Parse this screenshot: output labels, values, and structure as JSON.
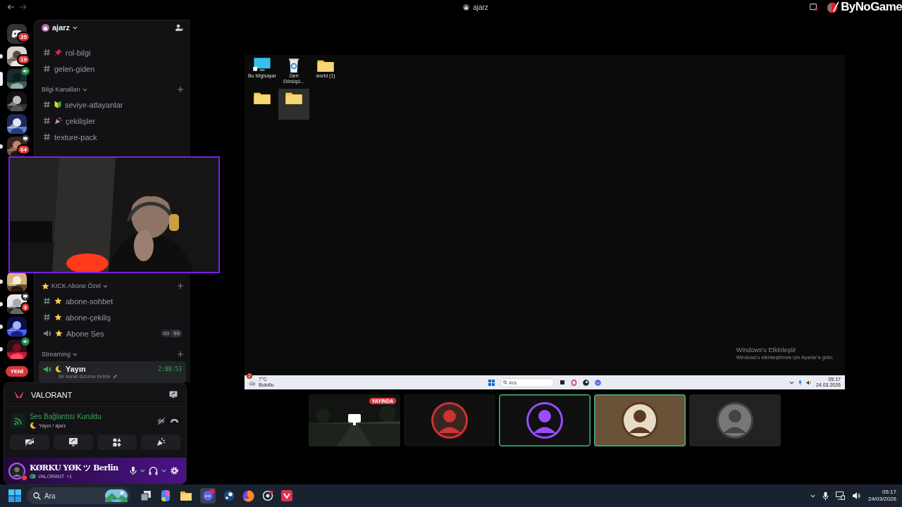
{
  "titlebar": {
    "title": "ajarz",
    "brand": "ByNoGame"
  },
  "servers": [
    {
      "kind": "home",
      "badge": "25",
      "unread": false,
      "selected": false
    },
    {
      "kind": "picture",
      "badge": "19",
      "unread": true,
      "selected": false
    },
    {
      "kind": "picture",
      "activity": {
        "kind": "voice"
      },
      "unread": false,
      "selected": true
    },
    {
      "kind": "picture",
      "unread": false,
      "selected": false
    },
    {
      "kind": "picture",
      "unread": false,
      "selected": false
    },
    {
      "kind": "picture",
      "badge": "64",
      "activity": {
        "kind": "screen"
      },
      "unread": true,
      "selected": false
    },
    {
      "kind": "picture",
      "unread": true,
      "selected": false
    },
    {
      "kind": "picture",
      "badge": "3",
      "activity": {
        "kind": "screen"
      },
      "unread": true,
      "selected": false
    },
    {
      "kind": "picture",
      "unread": true,
      "selected": false
    },
    {
      "kind": "picture",
      "activity": {
        "kind": "voice"
      },
      "unread": true,
      "selected": false
    }
  ],
  "new_badge": "YENİ",
  "server_header": {
    "name": "ajarz"
  },
  "sections": [
    {
      "channels": [
        {
          "kind": "text",
          "emoji": {
            "kind": "pin"
          },
          "name": "rol-bilgi",
          "selected": false
        },
        {
          "kind": "text",
          "name": "gelen-giden",
          "selected": false
        }
      ]
    },
    {
      "name": "Bilgi Kanalları",
      "channels": [
        {
          "kind": "text",
          "emoji": {
            "kind": "beginner"
          },
          "name": "seviye-atlayanlar",
          "selected": false
        },
        {
          "kind": "text",
          "emoji": {
            "kind": "party"
          },
          "name": "çekilişler",
          "selected": false
        },
        {
          "kind": "text",
          "name": "texture-pack",
          "selected": false
        }
      ]
    },
    {
      "name": "KICK Abone Özel",
      "emoji": {
        "kind": "star"
      },
      "channels": [
        {
          "kind": "text",
          "emoji": {
            "kind": "star"
          },
          "name": "abone-sohbet",
          "selected": false
        },
        {
          "kind": "text",
          "emoji": {
            "kind": "star"
          },
          "name": "abone-çekiliş",
          "selected": false
        },
        {
          "kind": "voice",
          "emoji": {
            "kind": "star"
          },
          "name": "Abone Ses",
          "selected": false,
          "connected": false,
          "user_count": "00",
          "user_limit": "99"
        }
      ]
    },
    {
      "name": "Streaming",
      "channels": [
        {
          "kind": "voice",
          "emoji": {
            "kind": "moon"
          },
          "name": "Yayın",
          "selected": true,
          "connected": true,
          "duration": "2:08:53",
          "status": "Bir kanal durumu belirle"
        }
      ]
    }
  ],
  "activity_panel": {
    "game": "VALORANT"
  },
  "voice_panel": {
    "status": "Ses Bağlantısı Kuruldu",
    "emoji": {
      "kind": "moon"
    },
    "channel": "Yayın / ajarz"
  },
  "user": {
    "name": "KØRKU YØK ツ Berlin",
    "do_not_disturb": true,
    "activity": "VALORANT",
    "extra": "+1"
  },
  "screen_share": {
    "desktop_icons": [
      {
        "kind": "computer",
        "label": "Bu bilgisayar",
        "selected": false
      },
      {
        "kind": "recycle",
        "label": "Geri Dönüşü...",
        "selected": false
      },
      {
        "kind": "folder",
        "label": "world (1)",
        "selected": false
      },
      {
        "kind": "folder",
        "selected": false
      },
      {
        "kind": "folder",
        "selected": true
      }
    ],
    "activation": {
      "title": "Windows'u Etkinleştir",
      "message": "Windows'u etkinleştirmek için Ayarlar'a gidin."
    },
    "taskbar": {
      "weather_badge": "2",
      "temperature": "7°C",
      "condition": "Bulutlu",
      "search_placeholder": "Ara",
      "time": "05:17",
      "date": "24.03.2026"
    }
  },
  "participants": [
    {
      "kind": "stream",
      "badge": "YAYINDA",
      "speaking": false
    },
    {
      "kind": "avatar",
      "speaking": false
    },
    {
      "kind": "avatar",
      "speaking": true
    },
    {
      "kind": "avatar",
      "speaking": true
    },
    {
      "kind": "avatar",
      "speaking": false
    }
  ],
  "taskbar": {
    "search_placeholder": "Ara",
    "time": "05:17",
    "date": "24/03/2026"
  }
}
